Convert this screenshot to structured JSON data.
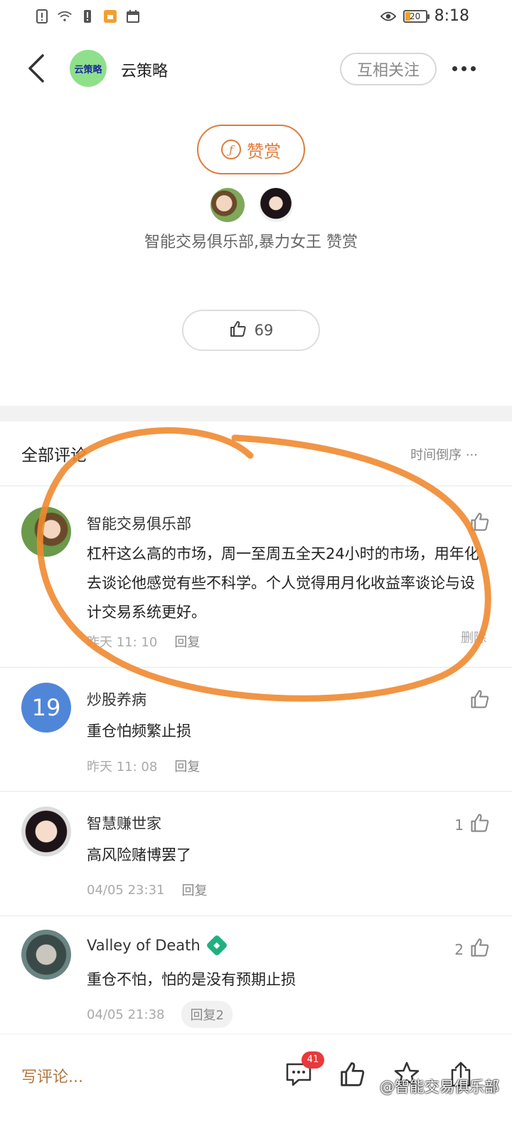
{
  "status_bar": {
    "time": "8:18",
    "battery": "20"
  },
  "header": {
    "logo_text": "云策略",
    "account_name": "云策略",
    "follow_label": "互相关注"
  },
  "reward": {
    "button_label": "赞赏",
    "coin_symbol": "ƒ",
    "donors_text": "智能交易俱乐部,暴力女王 赞赏"
  },
  "like": {
    "count": "69"
  },
  "comments_section": {
    "title": "全部评论",
    "sort_label": "时间倒序 ···"
  },
  "comments": [
    {
      "name": "智能交易俱乐部",
      "text": "杠杆这么高的市场，周一至周五全天24小时的市场，用年化去谈论他感觉有些不科学。个人觉得用月化收益率谈论与设计交易系统更好。",
      "time": "昨天 11: 10",
      "reply": "回复",
      "delete": "删除"
    },
    {
      "name": "炒股养病",
      "avatar_text": "19",
      "text": "重仓怕频繁止损",
      "time": "昨天 11: 08",
      "reply": "回复"
    },
    {
      "name": "智慧赚世家",
      "text": "高风险赌博罢了",
      "time": "04/05 23:31",
      "reply": "回复",
      "likes": "1"
    },
    {
      "name": "Valley of Death",
      "text": "重仓不怕，怕的是没有预期止损",
      "time": "04/05 21:38",
      "reply": "回复2",
      "likes": "2"
    }
  ],
  "bottom_bar": {
    "write_label": "写评论...",
    "comment_count": "41",
    "watermark": "@智能交易俱乐部"
  },
  "colors": {
    "accent": "#e07b3a",
    "annotation": "#f08a30",
    "badge": "#e83a3a"
  }
}
